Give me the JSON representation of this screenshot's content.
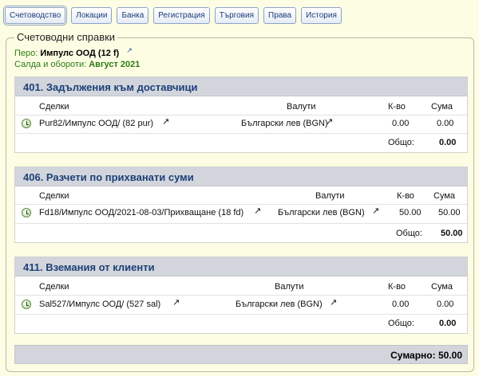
{
  "tabs": [
    {
      "label": "Счетоводство",
      "active": true
    },
    {
      "label": "Локации"
    },
    {
      "label": "Банка"
    },
    {
      "label": "Регистрация"
    },
    {
      "label": "Търговия"
    },
    {
      "label": "Права"
    },
    {
      "label": "История"
    }
  ],
  "report": {
    "title": "Счетоводни справки",
    "pero_label": "Перо:",
    "pero_value": "Импулс ООД (12 f)",
    "ext_glyph": "↗",
    "period_label": "Салда и обороти:",
    "period_value": "Август 2021"
  },
  "columns": {
    "deals": "Сделки",
    "currencies": "Валути",
    "qty": "К-во",
    "amount": "Сума"
  },
  "panels": [
    {
      "title": "401. Задължения към доставчици",
      "deal": "Pur82/Импулс ООД/ (82 pur)",
      "currency": "Български лев (BGN)",
      "qty": "0.00",
      "amount": "0.00",
      "total_label": "Общо:",
      "total": "0.00"
    },
    {
      "title": "406. Разчети по прихванати суми",
      "deal": "Fd18/Импулс ООД/2021-08-03/Прихващане (18 fd)",
      "currency": "Български лев (BGN)",
      "qty": "50.00",
      "amount": "50.00",
      "total_label": "Общо:",
      "total": "50.00"
    },
    {
      "title": "411. Вземания от клиенти",
      "deal": "Sal527/Импулс ООД/ (527 sal)",
      "currency": "Български лев (BGN)",
      "qty": "0.00",
      "amount": "0.00",
      "total_label": "Общо:",
      "total": "0.00"
    }
  ],
  "summary": {
    "label": "Сумарно:",
    "value": "50.00"
  }
}
